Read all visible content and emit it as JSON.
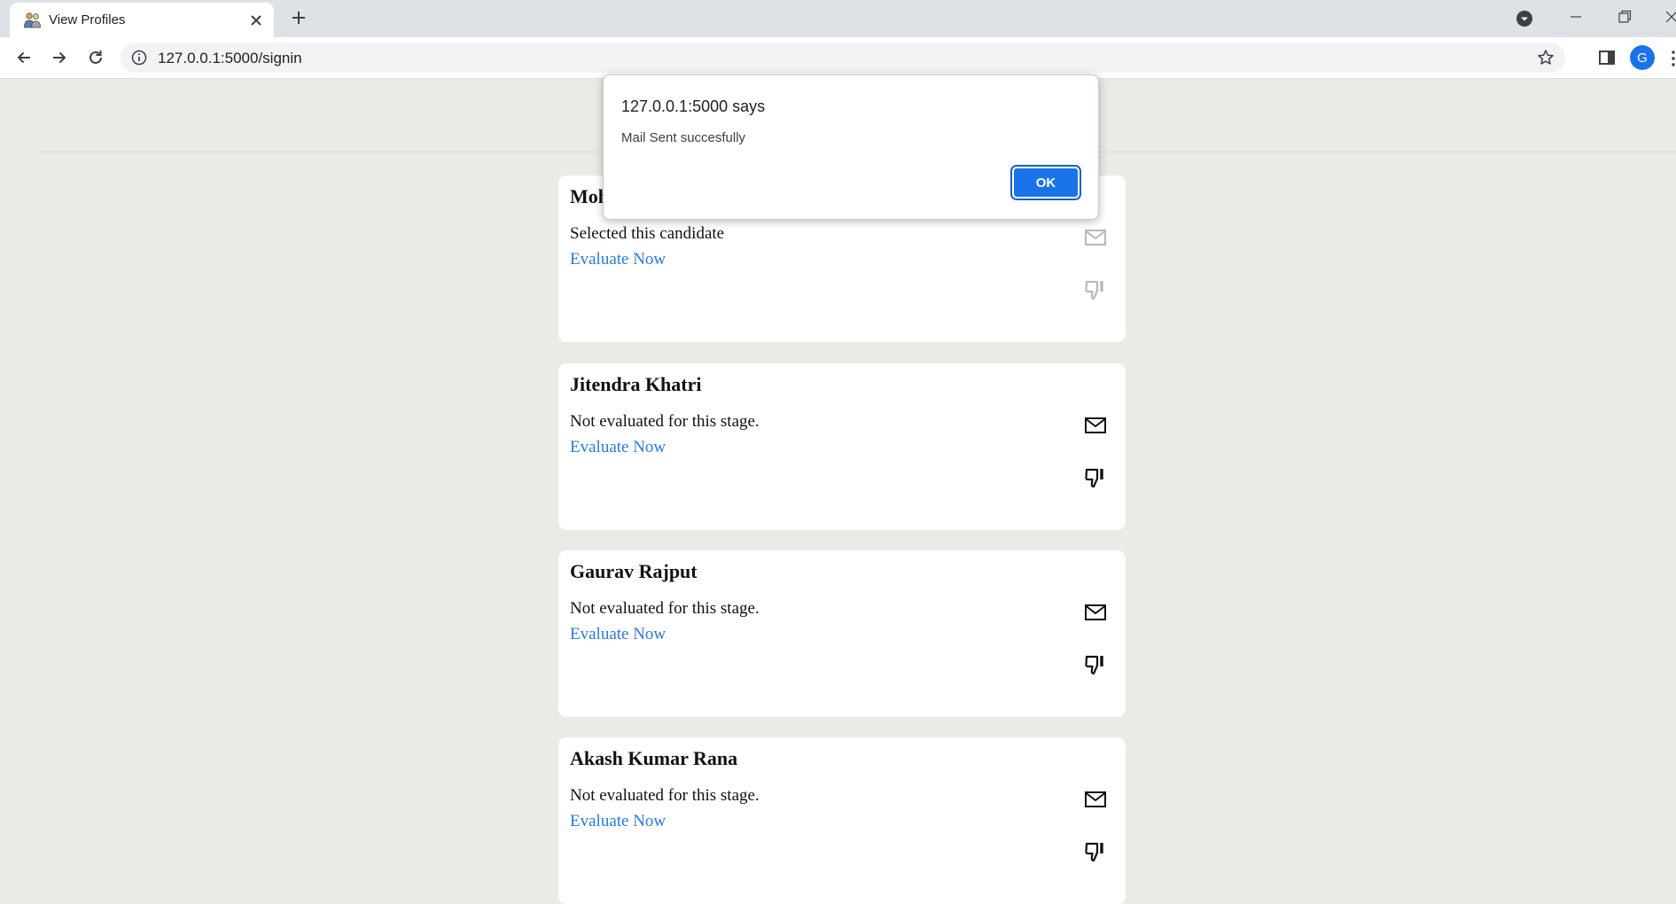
{
  "browser": {
    "tab_title": "View Profiles",
    "url": "127.0.0.1:5000/signin",
    "profile_initial": "G",
    "icons": {
      "favicon": "people-favicon-icon",
      "tab_close": "close-icon",
      "new_tab": "plus-icon",
      "back": "arrow-left-icon",
      "forward": "arrow-right-icon",
      "reload": "reload-icon",
      "site_info": "info-icon",
      "bookmark": "star-icon",
      "side_panel": "side-panel-icon"
    }
  },
  "alert": {
    "title": "127.0.0.1:5000 says",
    "message": "Mail Sent succesfully",
    "ok_label": "OK"
  },
  "candidates": [
    {
      "name": "Mohit",
      "status": "Selected this candidate",
      "link": "Evaluate Now"
    },
    {
      "name": "Jitendra Khatri",
      "status": "Not evaluated for this stage.",
      "link": "Evaluate Now"
    },
    {
      "name": "Gaurav Rajput",
      "status": "Not evaluated for this stage.",
      "link": "Evaluate Now"
    },
    {
      "name": "Akash Kumar Rana",
      "status": "Not evaluated for this stage.",
      "link": "Evaluate Now"
    }
  ],
  "colors": {
    "page_background": "#e9ebe5",
    "link": "#2b78d4",
    "ok_button": "#1a73e8"
  }
}
